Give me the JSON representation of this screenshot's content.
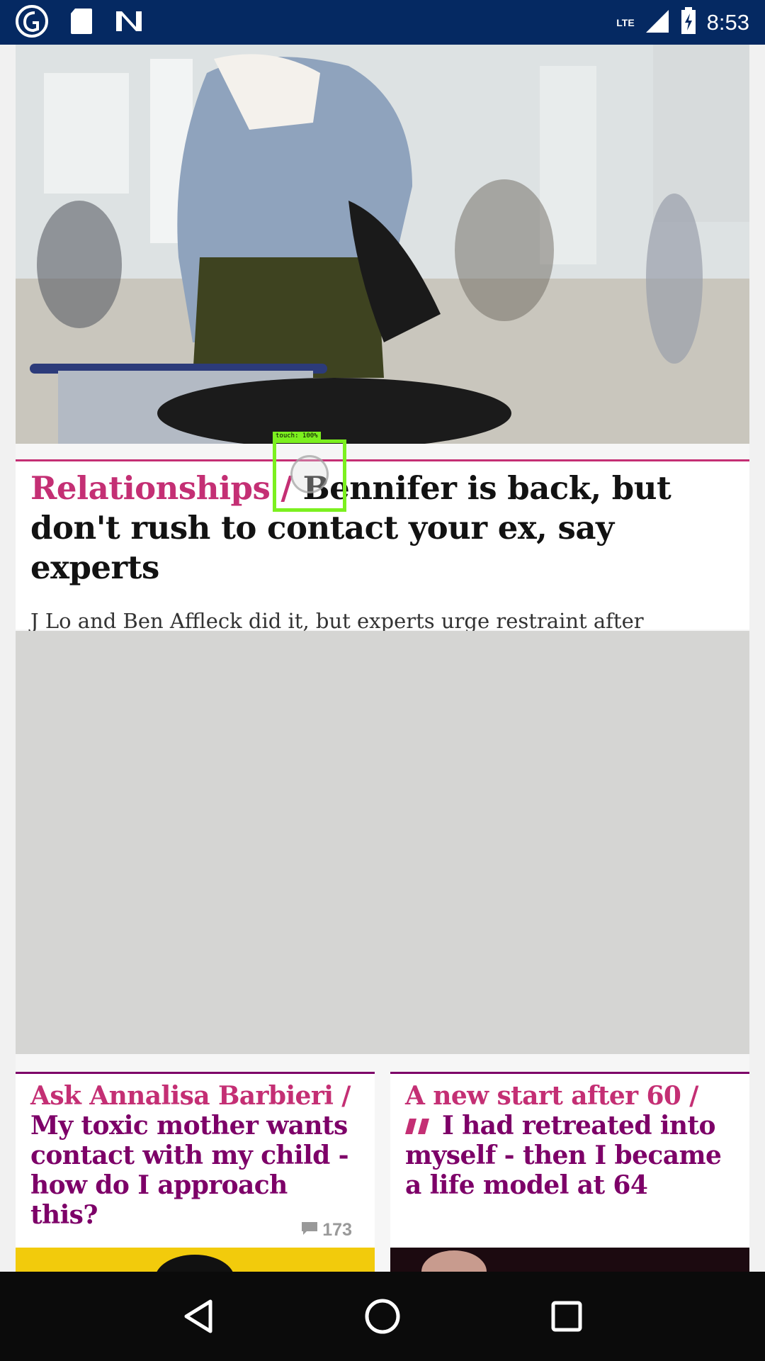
{
  "status_bar": {
    "time": "8:53",
    "network": "LTE",
    "icons": [
      "guardian-logo-icon",
      "sd-card-icon",
      "news-app-icon",
      "signal-icon",
      "battery-charging-icon"
    ],
    "background": "#052962"
  },
  "hero": {
    "kicker": "Relationships / ",
    "headline": "Bennifer is back, but don't rush to contact your ex, say experts",
    "standfirst": "J Lo and Ben Affleck did it, but experts urge restraint after lockdown prompts ‘rekindled romance’ dating trend",
    "accent_color": "#c42f74"
  },
  "cards": [
    {
      "kicker": "Ask Annalisa Barbieri / ",
      "headline": "My toxic mother wants contact with my child - how do I approach this?",
      "comments": "173"
    },
    {
      "kicker": "A new start after 60 / ",
      "headline": "I had retreated into myself - then I became a life model at 64",
      "icon": "quote-icon"
    }
  ],
  "touch_overlay": {
    "label": "touch: 100%"
  },
  "nav_bar": {
    "buttons": [
      "back-icon",
      "home-icon",
      "recents-icon"
    ]
  }
}
